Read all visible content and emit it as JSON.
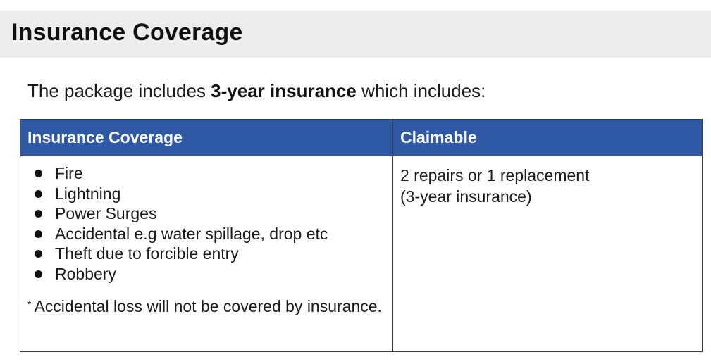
{
  "header": {
    "title": "Insurance Coverage"
  },
  "intro": {
    "before": "The package includes ",
    "bold": "3-year insurance",
    "after": " which includes:"
  },
  "table": {
    "headers": [
      "Insurance Coverage",
      "Claimable"
    ],
    "perils": [
      "Fire",
      "Lightning",
      "Power Surges",
      "Accidental e.g water spillage, drop etc",
      "Theft due to forcible entry",
      "Robbery"
    ],
    "footnote_marker": "*",
    "footnote": "Accidental loss will not be covered by insurance.",
    "claimable_line1": "2 repairs or 1 replacement",
    "claimable_line2": "(3-year insurance)"
  },
  "colors": {
    "header_bar": "#ededed",
    "table_header": "#2f59a4",
    "table_header_text": "#ffffff",
    "border": "#3a3a3a"
  }
}
